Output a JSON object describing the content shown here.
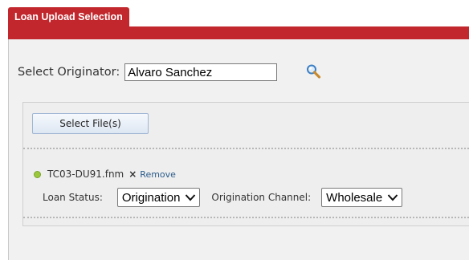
{
  "tab": {
    "label": "Loan Upload Selection"
  },
  "originator": {
    "label": "Select Originator:",
    "value": "Alvaro Sanchez"
  },
  "upload": {
    "select_files_label": "Select File(s)",
    "file": {
      "name": "TC03-DU91.fnm",
      "remove_symbol": "×",
      "remove_label": "Remove"
    },
    "loan_status": {
      "label": "Loan Status:",
      "selected": "Origination"
    },
    "origination_channel": {
      "label": "Origination Channel:",
      "selected": "Wholesale"
    }
  },
  "colors": {
    "brand_red": "#c1272d",
    "panel_bg": "#f1f1f1",
    "status_green": "#9bc83b",
    "link_blue": "#2a5b8a"
  },
  "icons": {
    "search": "search-icon",
    "dropdown": "chevron-down-icon",
    "status": "status-dot-icon"
  }
}
